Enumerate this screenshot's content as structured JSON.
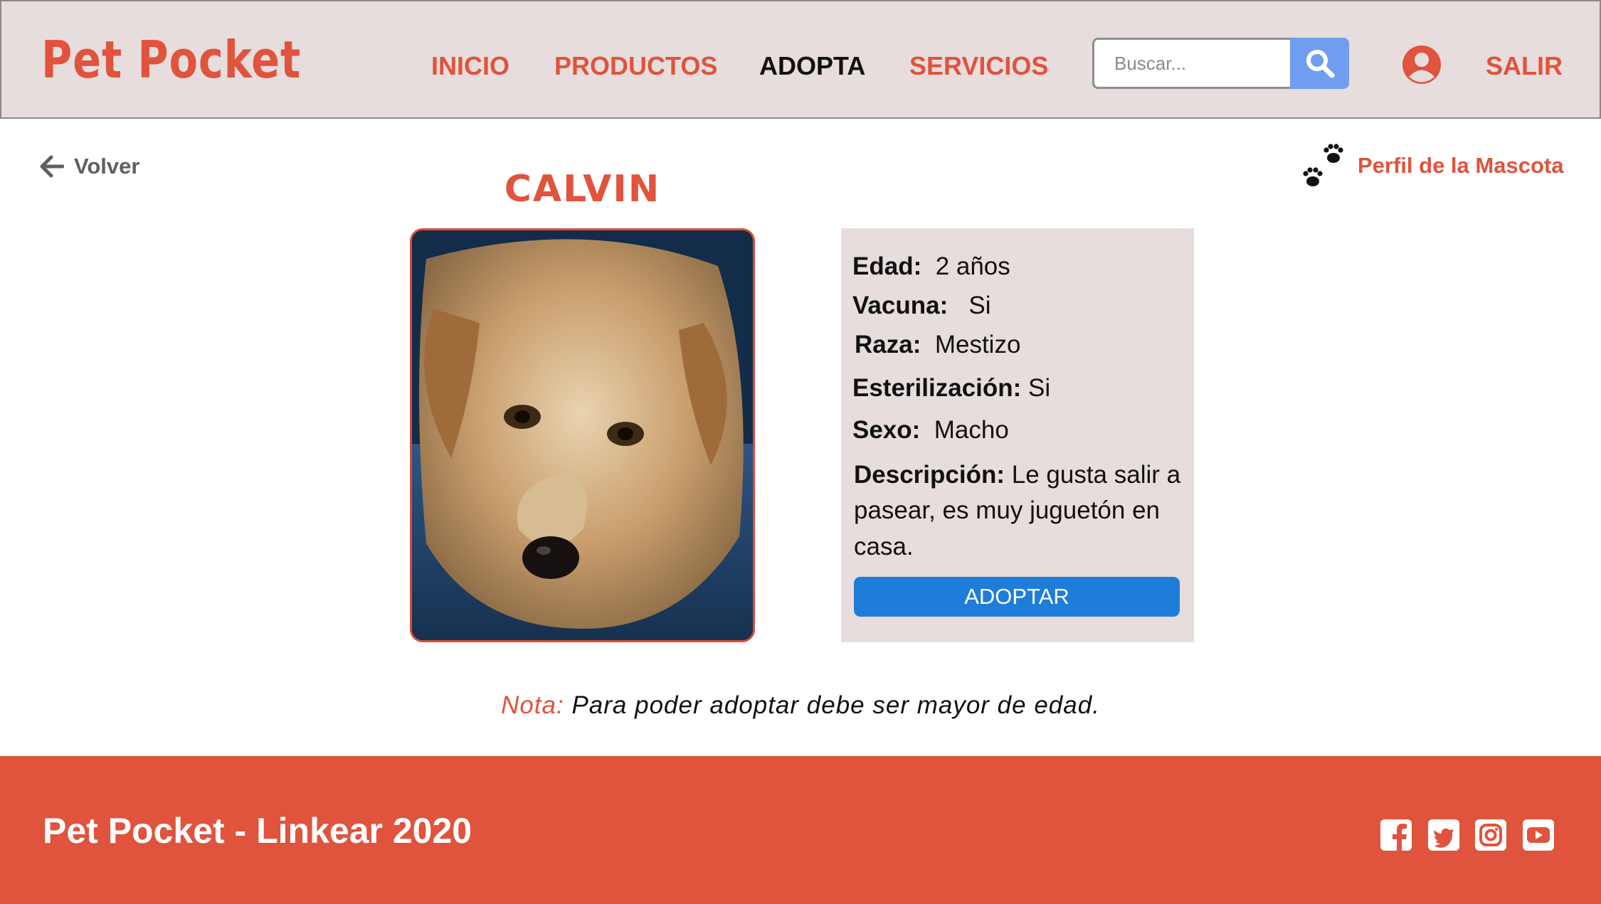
{
  "brand": {
    "name": "Pet Pocket",
    "accent": "#e0533c",
    "header_bg": "#e7dddd",
    "button_blue": "#1e7dd9",
    "search_blue": "#6f9df0"
  },
  "nav": [
    {
      "label": "INICIO",
      "active": false
    },
    {
      "label": "PRODUCTOS",
      "active": false
    },
    {
      "label": "ADOPTA",
      "active": true
    },
    {
      "label": "SERVICIOS",
      "active": false
    }
  ],
  "search": {
    "placeholder": "Buscar...",
    "icon": "search-icon"
  },
  "header": {
    "user_icon": "user-circle-icon",
    "logout_label": "SALIR"
  },
  "back": {
    "label": "Volver",
    "icon": "arrow-left-icon"
  },
  "profile": {
    "label": "Perfil de la Mascota",
    "icon": "paw-prints-icon"
  },
  "pet": {
    "name": "CALVIN",
    "photo": "scruffy tan terrier mix dog lying on a blue couch",
    "fields": [
      {
        "label": "Edad:",
        "value": "2 años"
      },
      {
        "label": "Vacuna:",
        "value": "Si"
      },
      {
        "label": "Raza:",
        "value": "Mestizo"
      },
      {
        "label": "Esterilización:",
        "value": "Si"
      },
      {
        "label": "Sexo:",
        "value": "Macho"
      }
    ],
    "description_label": "Descripción:",
    "description": "Le gusta salir a pasear, es muy juguetón en casa.",
    "adopt_button": "ADOPTAR"
  },
  "note": {
    "label": "Nota:",
    "text": "Para poder adoptar debe ser mayor de edad."
  },
  "footer": {
    "text": "Pet Pocket - Linkear 2020",
    "social": [
      "facebook-icon",
      "twitter-icon",
      "instagram-icon",
      "youtube-icon"
    ]
  }
}
